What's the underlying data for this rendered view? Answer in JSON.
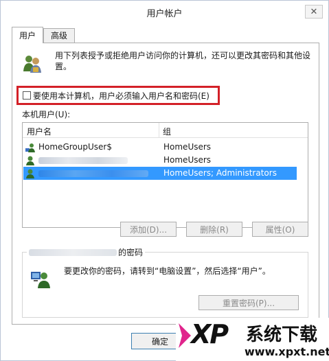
{
  "window": {
    "title": "用户帐户",
    "close_glyph": "✕"
  },
  "tabs": [
    {
      "label": "用户",
      "active": true
    },
    {
      "label": "高级",
      "active": false
    }
  ],
  "intro": {
    "text": "用下列表授予或拒绝用户访问你的计算机，还可以更改其密码和其他设置。",
    "icon": "users-icon"
  },
  "require_login": {
    "label": "要使用本计算机，用户必须输入用户名和密码(E)",
    "checked": false
  },
  "users_section": {
    "label": "本机用户(U):"
  },
  "users_table": {
    "columns": [
      "用户名",
      "组"
    ],
    "rows": [
      {
        "name": "HomeGroupUser$",
        "group": "HomeUsers",
        "selected": false
      },
      {
        "name": "",
        "group": "HomeUsers",
        "selected": false
      },
      {
        "name": "",
        "group": "HomeUsers; Administrators",
        "selected": true
      }
    ]
  },
  "actions": {
    "add": "添加(D)...",
    "remove": "删除(R)",
    "properties": "属性(O)"
  },
  "password_group": {
    "title": "的密码",
    "text": "要更改你的密码，请转到“电脑设置”，然后选择“用户”。",
    "reset_button": "重置密码(P)..."
  },
  "footer": {
    "ok": "确定"
  },
  "watermark": {
    "logo": "XP",
    "text": "系统下载",
    "url": "www.xpxt.net"
  },
  "colors": {
    "selection": "#3399ff",
    "highlight_border": "#d32027",
    "watermark_pink": "#e0248c"
  }
}
